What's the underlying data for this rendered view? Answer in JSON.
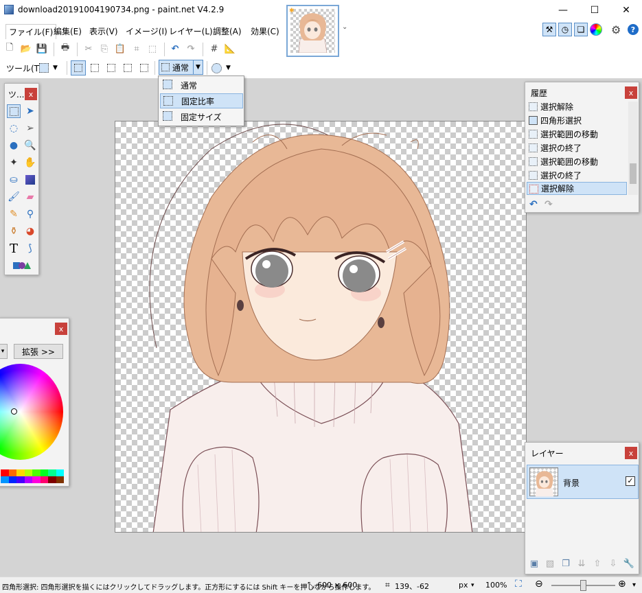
{
  "window": {
    "title": "download20191004190734.png - paint.net V4.2.9",
    "minimize": "—",
    "maximize": "☐",
    "close": "✕"
  },
  "menu": [
    "ファイル(F)",
    "編集(E)",
    "表示(V)",
    "イメージ(I)",
    "レイヤー(L)",
    "調整(A)",
    "効果(C)"
  ],
  "tab_overflow": "⌄",
  "toolbar_icons": [
    "new-icon",
    "open-icon",
    "save-icon",
    "print-icon",
    "cut-icon",
    "copy-icon",
    "paste-icon",
    "crop-icon",
    "deselect-icon",
    "undo-icon",
    "redo-icon",
    "grid-icon",
    "ruler-icon"
  ],
  "right_icons": [
    "tools-window-icon",
    "history-window-icon",
    "layers-window-icon",
    "colors-window-icon",
    "settings-icon",
    "help-icon"
  ],
  "tool_row": {
    "label": "ツール(T):",
    "mode_selected": "通常"
  },
  "mode_menu": [
    {
      "label": "通常",
      "active": false
    },
    {
      "label": "固定比率",
      "active": true
    },
    {
      "label": "固定サイズ",
      "active": false
    }
  ],
  "tools_panel": {
    "title": "ツ...",
    "close": "x",
    "tools": [
      "rectangle-select-icon",
      "move-selection-icon",
      "lasso-select-icon",
      "move-selected-icon",
      "ellipse-select-icon",
      "zoom-icon",
      "magic-wand-icon",
      "pan-icon",
      "paint-bucket-icon",
      "gradient-icon",
      "paintbrush-icon",
      "eraser-icon",
      "pencil-icon",
      "color-picker-icon",
      "clone-stamp-icon",
      "recolor-icon",
      "text-icon",
      "line-curve-icon",
      "shapes-icon"
    ],
    "text_glyph": "T"
  },
  "history_panel": {
    "title": "履歴",
    "close": "x",
    "items": [
      {
        "label": "選択解除",
        "active": false
      },
      {
        "label": "四角形選択",
        "active": false
      },
      {
        "label": "選択範囲の移動",
        "active": false
      },
      {
        "label": "選択の終了",
        "active": false
      },
      {
        "label": "選択範囲の移動",
        "active": false
      },
      {
        "label": "選択の終了",
        "active": false
      },
      {
        "label": "選択解除",
        "active": true
      }
    ]
  },
  "layers_panel": {
    "title": "レイヤー",
    "close": "x",
    "layers": [
      {
        "name": "背景",
        "visible": true
      }
    ],
    "check": "✓"
  },
  "colors_panel": {
    "close": "x",
    "expand_label": "拡張 >>",
    "palette": [
      "#ff0000",
      "#ff6a00",
      "#ffd800",
      "#b6ff00",
      "#4cff00",
      "#00ff21",
      "#00ff90",
      "#00ffff",
      "#0094ff",
      "#0026ff",
      "#4800ff",
      "#b200ff",
      "#ff00dc",
      "#ff006e",
      "#7f0000",
      "#7f3300"
    ]
  },
  "status": {
    "hint": "四角形選択: 四角形選択を描くにはクリックしてドラッグします。正方形にするには Shift キーを押しながら操作します。",
    "image_size": "600 × 600",
    "cursor_pos": "139、-62",
    "unit": "px",
    "zoom": "100%",
    "zoom_level": 0.5
  },
  "colors": {
    "accent": "#cfe3f7",
    "accent_border": "#5a8fc7",
    "close_red": "#c8413b",
    "workspace": "#d4d4d4"
  }
}
